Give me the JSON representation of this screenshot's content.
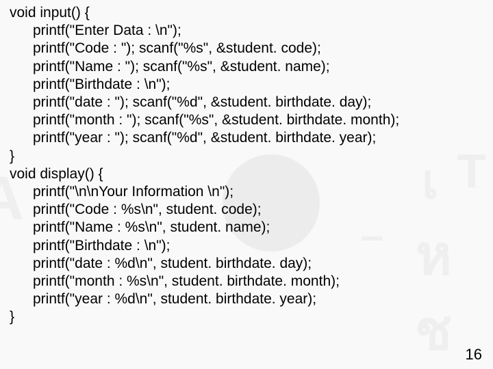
{
  "code": {
    "l1": "void input() {",
    "l2": "printf(\"Enter Data : \\n\");",
    "l3": "printf(\"Code : \"); scanf(\"%s\", &student. code);",
    "l4": "printf(\"Name : \"); scanf(\"%s\", &student. name);",
    "l5": "printf(\"Birthdate : \\n\");",
    "l6": "printf(\"date : \"); scanf(\"%d\", &student. birthdate. day);",
    "l7": "printf(\"month : \"); scanf(\"%s\", &student. birthdate. month);",
    "l8": "printf(\"year : \"); scanf(\"%d\", &student. birthdate. year);",
    "l9": "}",
    "l10": "void display() {",
    "l11": "printf(\"\\n\\nYour Information \\n\");",
    "l12": "printf(\"Code : %s\\n\", student. code);",
    "l13": "printf(\"Name : %s\\n\", student. name);",
    "l14": "printf(\"Birthdate : \\n\");",
    "l15": "printf(\"date : %d\\n\", student. birthdate. day);",
    "l16": "printf(\"month : %s\\n\", student. birthdate. month);",
    "l17": "printf(\"year : %d\\n\", student. birthdate. year);",
    "l18": "}"
  },
  "page_number": "16",
  "chart_data": {
    "type": "table",
    "title": "C source code – struct I/O example (slide 16)",
    "functions": [
      {
        "name": "input",
        "return": "void",
        "body": [
          "printf(\"Enter Data : \\n\");",
          "printf(\"Code : \"); scanf(\"%s\", &student.code);",
          "printf(\"Name : \"); scanf(\"%s\", &student.name);",
          "printf(\"Birthdate : \\n\");",
          "printf(\"date : \"); scanf(\"%d\", &student.birthdate.day);",
          "printf(\"month : \"); scanf(\"%s\", &student.birthdate.month);",
          "printf(\"year : \"); scanf(\"%d\", &student.birthdate.year);"
        ]
      },
      {
        "name": "display",
        "return": "void",
        "body": [
          "printf(\"\\n\\nYour Information \\n\");",
          "printf(\"Code : %s\\n\", student.code);",
          "printf(\"Name : %s\\n\", student.name);",
          "printf(\"Birthdate : \\n\");",
          "printf(\"date : %d\\n\", student.birthdate.day);",
          "printf(\"month : %s\\n\", student.birthdate.month);",
          "printf(\"year : %d\\n\", student.birthdate.year);"
        ]
      }
    ]
  }
}
